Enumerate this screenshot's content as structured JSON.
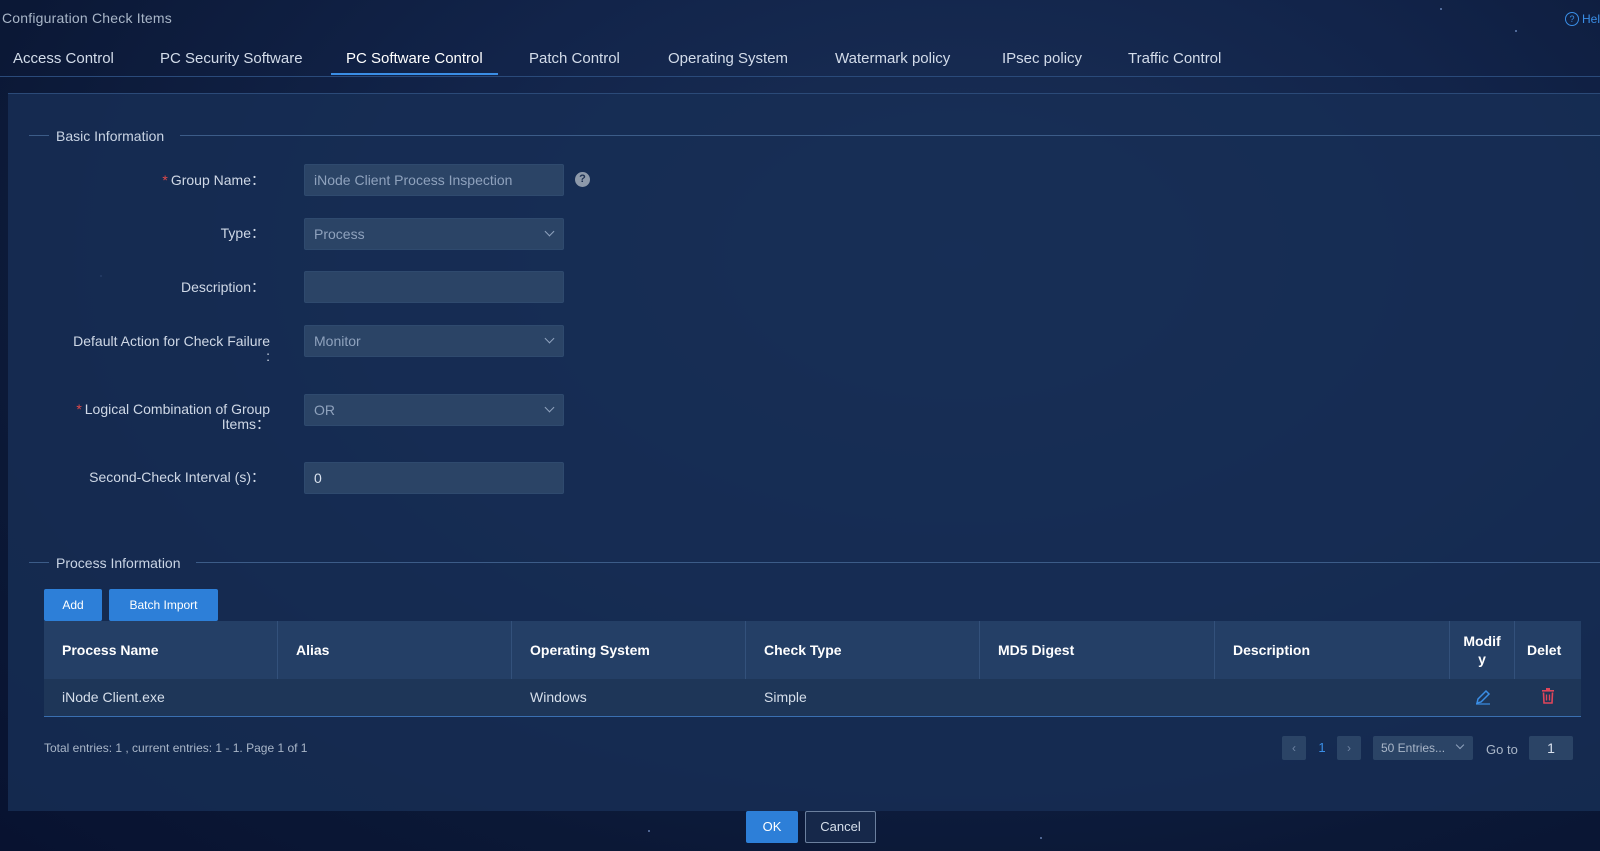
{
  "page_title": "Configuration Check Items",
  "help_label": "Hel",
  "tabs": [
    {
      "label": "Access Control"
    },
    {
      "label": "PC Security Software"
    },
    {
      "label": "PC Software Control",
      "active": true
    },
    {
      "label": "Patch Control"
    },
    {
      "label": "Operating System"
    },
    {
      "label": "Watermark policy"
    },
    {
      "label": "IPsec policy"
    },
    {
      "label": "Traffic Control"
    }
  ],
  "basic_info": {
    "title": "Basic Information",
    "fields": {
      "group_name": {
        "label": "Group Name",
        "value": "iNode Client Process Inspection",
        "required": true
      },
      "type": {
        "label": "Type",
        "value": "Process"
      },
      "description": {
        "label": "Description",
        "value": ""
      },
      "default_action": {
        "label_line1": "Default Action for Check Failure",
        "label_line2": ":",
        "value": "Monitor"
      },
      "logical_combination": {
        "label_line1": "Logical Combination of Group",
        "label_line2": "Items",
        "value": "OR",
        "required": true
      },
      "second_check": {
        "label": "Second-Check Interval (s)",
        "value": "0"
      }
    },
    "colon": "："
  },
  "process_info": {
    "title": "Process Information",
    "add_label": "Add",
    "batch_import_label": "Batch Import",
    "columns": [
      "Process Name",
      "Alias",
      "Operating System",
      "Check Type",
      "MD5 Digest",
      "Description",
      "Modify",
      "Delete"
    ],
    "modify_header_lines": [
      "Modif",
      "y"
    ],
    "delete_header": "Delet",
    "rows": [
      {
        "process_name": "iNode Client.exe",
        "alias": "",
        "os": "Windows",
        "check_type": "Simple",
        "md5": "",
        "description": ""
      }
    ]
  },
  "pagination": {
    "summary": "Total entries: 1 , current entries: 1 - 1. Page 1 of 1",
    "current_page": "1",
    "page_size": "50 Entries...",
    "goto_label": "Go to",
    "goto_value": "1"
  },
  "actions": {
    "ok": "OK",
    "cancel": "Cancel"
  },
  "colors": {
    "accent": "#2d7fd8",
    "required": "#e04a4a",
    "delete_icon": "#e0455a"
  },
  "icons": {
    "help": "question-circle-icon",
    "tooltip": "question-icon",
    "edit": "pencil-icon",
    "delete": "trash-icon",
    "prev": "chevron-left-icon",
    "next": "chevron-right-icon"
  }
}
